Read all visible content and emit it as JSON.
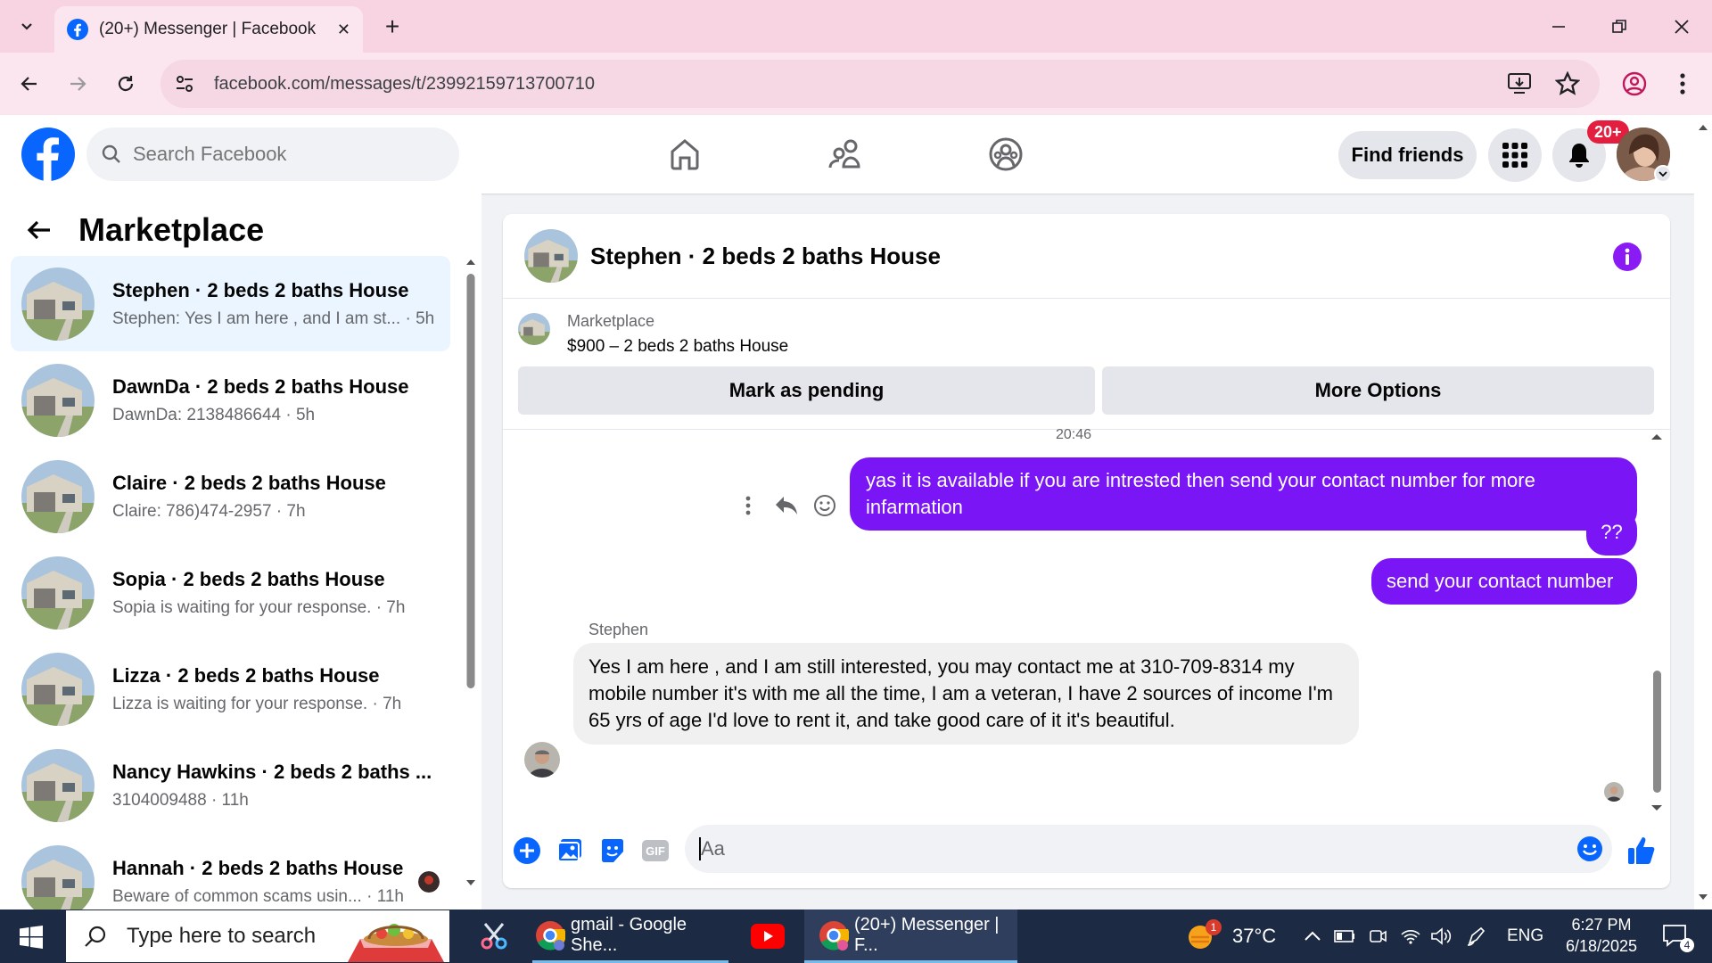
{
  "browser": {
    "tab_title": "(20+) Messenger | Facebook",
    "url": "facebook.com/messages/t/23992159713700710",
    "new_tab_symbol": "+",
    "close_tab_symbol": "✕"
  },
  "fb_header": {
    "search_placeholder": "Search Facebook",
    "find_friends_label": "Find friends",
    "notification_badge": "20+"
  },
  "sidebar": {
    "title": "Marketplace",
    "conversations": [
      {
        "name": "Stephen · 2 beds 2 baths House",
        "preview": "Stephen: Yes I am here , and I am st... · 5h",
        "active": true
      },
      {
        "name": "DawnDa · 2 beds 2 baths House",
        "preview": "DawnDa: 2138486644 · 5h",
        "active": false
      },
      {
        "name": "Claire · 2 beds 2 baths House",
        "preview": "Claire: 786)474-2957 · 7h",
        "active": false
      },
      {
        "name": "Sopia · 2 beds 2 baths House",
        "preview": "Sopia is waiting for your response. · 7h",
        "active": false
      },
      {
        "name": "Lizza · 2 beds 2 baths House",
        "preview": "Lizza is waiting for your response. · 7h",
        "active": false
      },
      {
        "name": "Nancy Hawkins · 2 beds 2 baths ...",
        "preview": "3104009488 · 11h",
        "active": false
      },
      {
        "name": "Hannah · 2 beds 2 baths House",
        "preview": "Beware of common scams usin... · 11h",
        "active": false
      }
    ]
  },
  "chat": {
    "title": "Stephen · 2 beds 2 baths House",
    "marketplace_label": "Marketplace",
    "listing": "$900 – 2 beds 2 baths House",
    "mark_pending_label": "Mark as pending",
    "more_options_label": "More Options",
    "timestamp": "20:46",
    "outgoing": [
      "yas it is available if you are intrested then send your contact number for more infarmation",
      "??",
      "send your contact number"
    ],
    "sender_name": "Stephen",
    "incoming": "Yes I am here , and I am still interested, you may contact me at 310-709-8314  my mobile number it's with me all the time, I am a veteran, I have 2 sources of income I'm 65 yrs of age I'd love to rent it, and take good care of it it's beautiful.",
    "composer_placeholder": "Aa",
    "gif_label": "GIF"
  },
  "taskbar": {
    "search_placeholder": "Type here to search",
    "app1_label": "gmail - Google She...",
    "app2_label": "(20+) Messenger | F...",
    "temperature": "37°C",
    "weather_badge": "1",
    "language": "ENG",
    "time": "6:27 PM",
    "date": "6/18/2025",
    "notification_count": "4"
  },
  "colors": {
    "fb_blue": "#0866ff",
    "messenger_purple": "#7a16f5",
    "badge_red": "#e41e3f",
    "tabbar_pink": "#f8d3e2"
  }
}
